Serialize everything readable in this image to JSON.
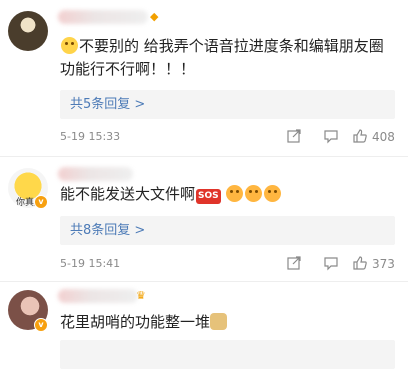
{
  "comments": [
    {
      "content": "不要别的 给我弄个语音拉进度条和编辑朋友圈功能行不行啊！！！",
      "content_line1": "不要别的 给我弄个语音拉进度条和编辑朋友圈",
      "content_line2": "功能行不行啊！！！",
      "replies_label": "共5条回复 >",
      "time": "5-19 15:33",
      "like_count": "408"
    },
    {
      "avatar_text": "你真丑",
      "content": "能不能发送大文件啊",
      "sos_text": "SOS",
      "replies_label": "共8条回复 >",
      "time": "5-19 15:41",
      "like_count": "373"
    },
    {
      "content": "花里胡哨的功能整一堆"
    }
  ],
  "colors": {
    "link": "#4d7bb7",
    "meta": "#8a8a8a",
    "reply_bg": "#f4f4f4",
    "badge": "#f7a010"
  },
  "icons": [
    "share-icon",
    "comment-icon",
    "like-icon"
  ]
}
